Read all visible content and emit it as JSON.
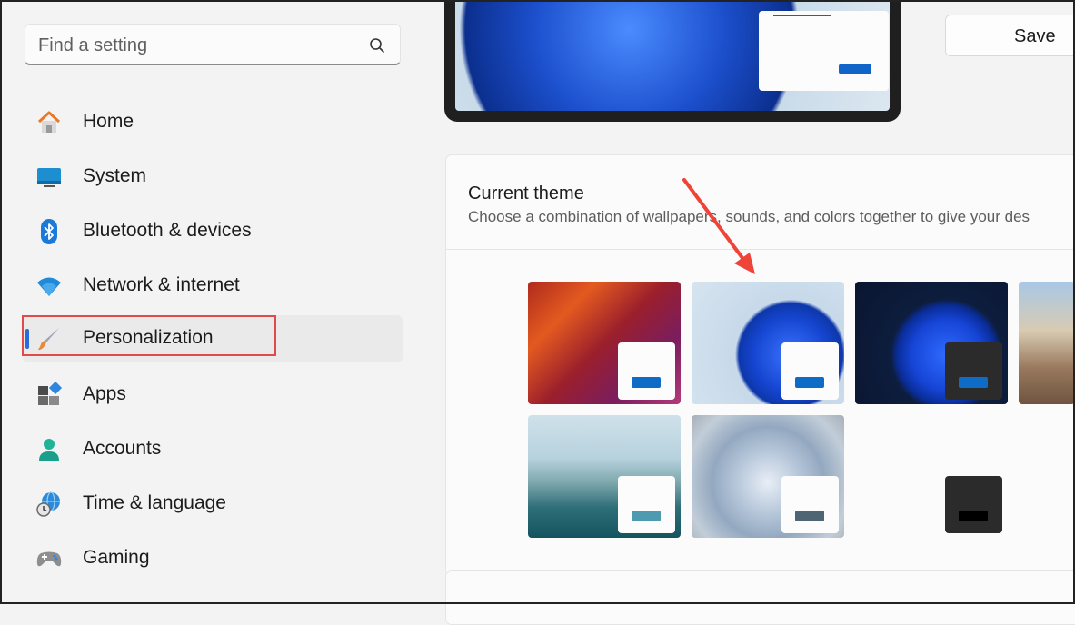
{
  "search": {
    "placeholder": "Find a setting",
    "icon": "search-icon"
  },
  "sidebar": {
    "items": [
      {
        "label": "Home",
        "icon": "home-icon"
      },
      {
        "label": "System",
        "icon": "monitor-icon"
      },
      {
        "label": "Bluetooth & devices",
        "icon": "bluetooth-icon"
      },
      {
        "label": "Network & internet",
        "icon": "wifi-icon"
      },
      {
        "label": "Personalization",
        "icon": "paintbrush-icon",
        "active": true
      },
      {
        "label": "Apps",
        "icon": "apps-icon"
      },
      {
        "label": "Accounts",
        "icon": "person-icon"
      },
      {
        "label": "Time & language",
        "icon": "globe-clock-icon"
      },
      {
        "label": "Gaming",
        "icon": "gamepad-icon"
      }
    ]
  },
  "toolbar": {
    "save_label": "Save"
  },
  "theme": {
    "title": "Current theme",
    "description": "Choose a combination of wallpapers, sounds, and colors together to give your des",
    "tiles": [
      {
        "name": "glow",
        "dark": false,
        "button_color": "#0f6cc6"
      },
      {
        "name": "windows-light",
        "dark": false,
        "button_color": "#0f6cc6"
      },
      {
        "name": "windows-dark",
        "dark": true,
        "button_color": "#0f6cc6"
      },
      {
        "name": "captured-motion",
        "dark": false,
        "button_color": "#4e9ab0"
      },
      {
        "name": "flow",
        "dark": false,
        "button_color": "#4f6573"
      },
      {
        "name": "sunrise",
        "dark": false,
        "button_color": "#0f6cc6"
      },
      {
        "name": "contrast",
        "dark": true,
        "button_color": "#000000"
      }
    ]
  },
  "colors": {
    "accent": "#2b6bd8",
    "highlight": "#e24a4a",
    "arrow": "#ef4438"
  }
}
